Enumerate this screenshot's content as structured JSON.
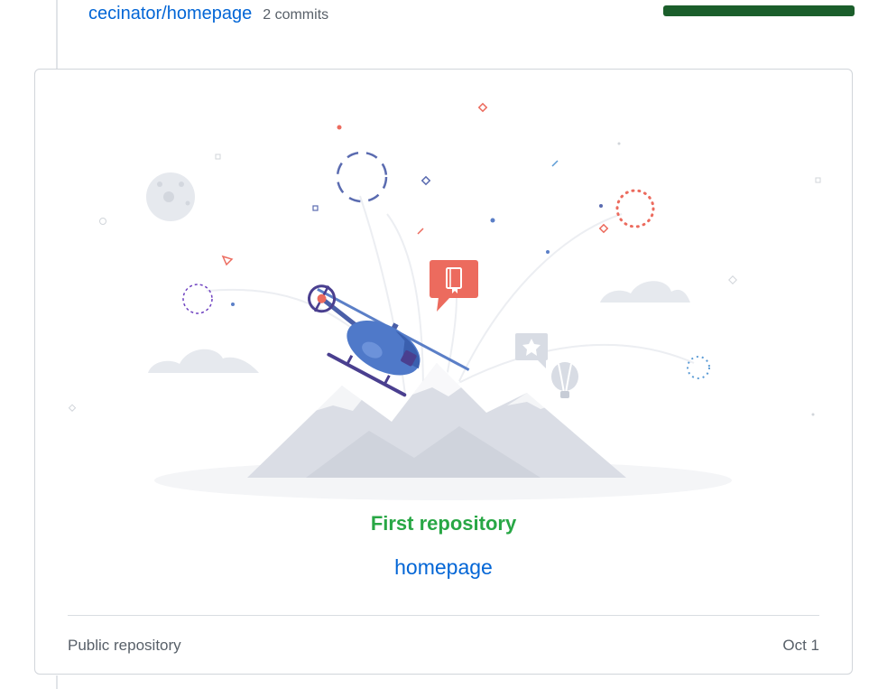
{
  "header": {
    "repo_link": "cecinator/homepage",
    "commit_count": "2 commits",
    "progress_fraction": 1.0,
    "progress_color": "#1b5e2b"
  },
  "card": {
    "milestone_title": "First repository",
    "repo_name": "homepage",
    "visibility": "Public repository",
    "date": "Oct 1",
    "illustration_icon": "helicopter-launch-illustration"
  },
  "colors": {
    "link": "#0366d6",
    "milestone": "#28a745",
    "muted": "#586069",
    "accent_red": "#ec6b5e",
    "accent_purple": "#6f42c1"
  }
}
